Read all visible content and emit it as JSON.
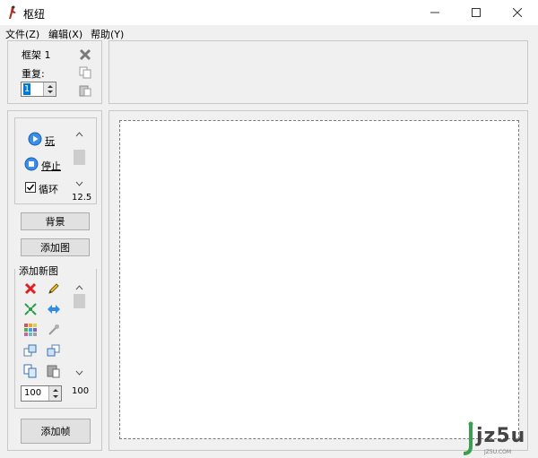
{
  "window": {
    "title": "枢纽"
  },
  "menu": {
    "file": "文件(Z)",
    "edit": "编辑(X)",
    "help": "帮助(Y)"
  },
  "frame_panel": {
    "frame_label": "框架 1",
    "repeat_label": "重复:",
    "repeat_value": "1"
  },
  "playback": {
    "play": "玩",
    "stop": "停止",
    "loop": "循环",
    "loop_checked": true,
    "speed": "12.5"
  },
  "buttons": {
    "background": "背景",
    "add_image": "添加图",
    "add_frame": "添加帧"
  },
  "tools": {
    "header": "添加新图",
    "zoom_value": "100",
    "scroll_value": "100"
  },
  "watermark": {
    "text": "jz5u",
    "sub": "JZ5U.COM"
  }
}
